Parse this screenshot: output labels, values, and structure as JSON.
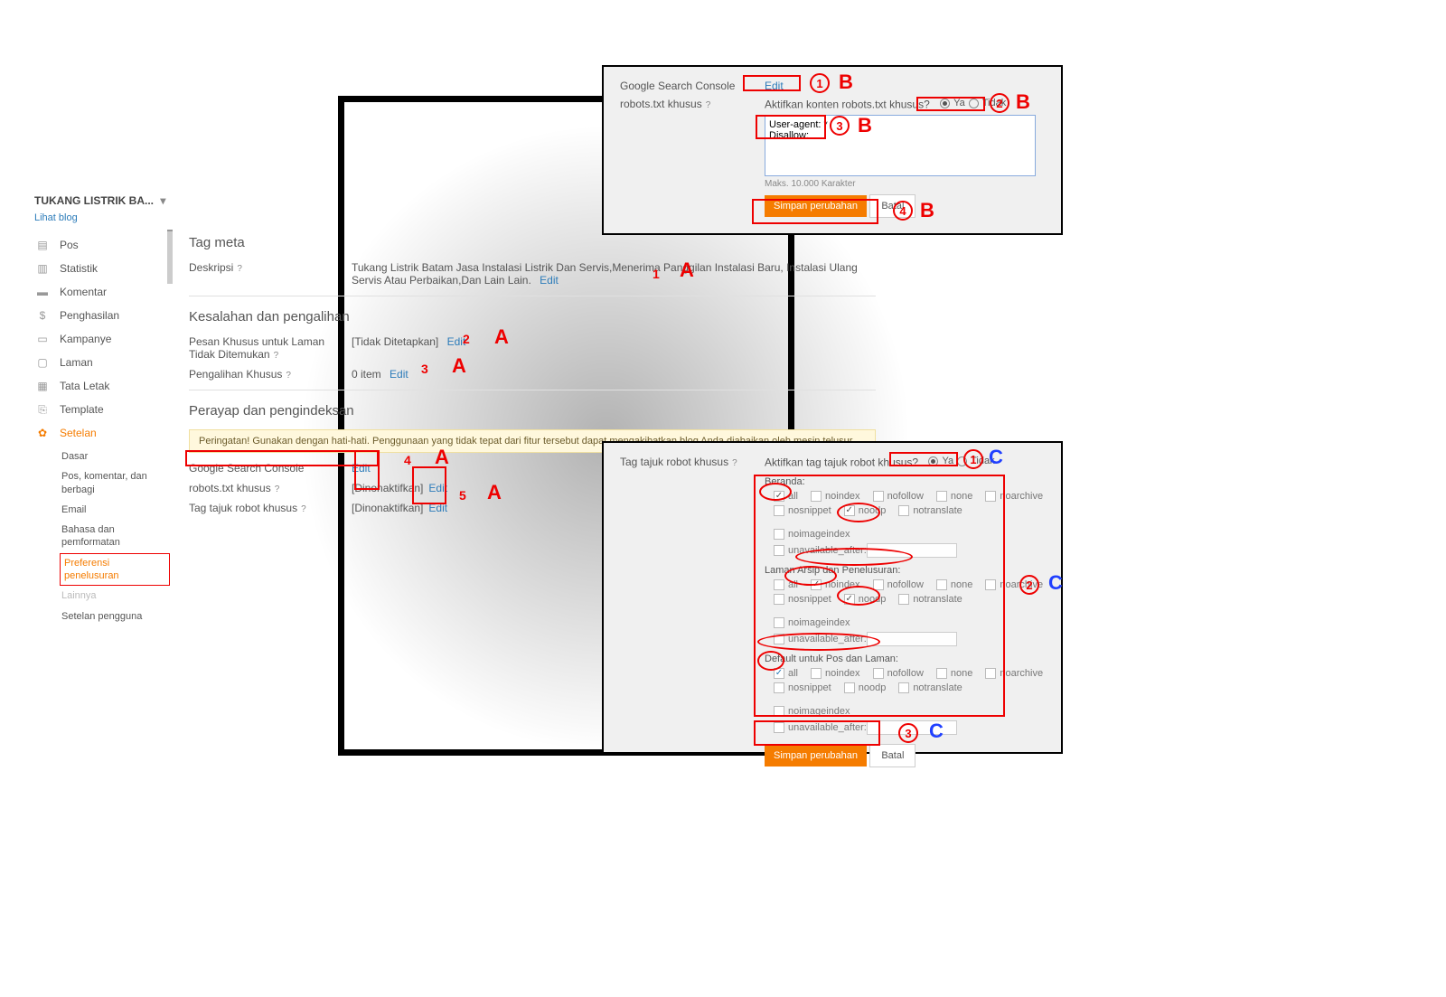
{
  "blog": {
    "title": "TUKANG LISTRIK BA...",
    "view_label": "Lihat blog"
  },
  "nav": [
    {
      "label": "Pos"
    },
    {
      "label": "Statistik"
    },
    {
      "label": "Komentar"
    },
    {
      "label": "Penghasilan"
    },
    {
      "label": "Kampanye"
    },
    {
      "label": "Laman"
    },
    {
      "label": "Tata Letak"
    },
    {
      "label": "Template"
    },
    {
      "label": "Setelan"
    }
  ],
  "subnav": [
    {
      "label": "Dasar"
    },
    {
      "label": "Pos, komentar, dan berbagi"
    },
    {
      "label": "Email"
    },
    {
      "label": "Bahasa dan pemformatan"
    },
    {
      "label": "Preferensi penelusuran"
    },
    {
      "label": "Lainnya"
    },
    {
      "label": "Setelan pengguna"
    }
  ],
  "sections": {
    "meta_title": "Tag meta",
    "errors_title": "Kesalahan dan pengalihan",
    "crawlers_title": "Perayap dan pengindeksan"
  },
  "meta": {
    "deskripsi_label": "Deskripsi",
    "deskripsi_value": "Tukang Listrik Batam Jasa Instalasi Listrik Dan Servis,Menerima Panggilan Instalasi Baru, Instalasi Ulang Servis Atau Perbaikan,Dan Lain Lain.",
    "edit": "Edit"
  },
  "errors": {
    "notfound_label": "Pesan Khusus untuk Laman Tidak Ditemukan",
    "notfound_value": "[Tidak Ditetapkan]",
    "redirect_label": "Pengalihan Khusus",
    "redirect_value": "0 item",
    "edit": "Edit"
  },
  "crawlers": {
    "warning": "Peringatan! Gunakan dengan hati-hati. Penggunaan yang tidak tepat dari fitur tersebut dapat mengakibatkan blog Anda diabaikan oleh mesin telusur.",
    "gsc_label": "Google Search Console",
    "robots_label": "robots.txt khusus",
    "header_label": "Tag tajuk robot khusus",
    "edit": "Edit",
    "disabled": "[Dinonaktifkan]"
  },
  "panelB": {
    "gsc_label": "Google Search Console",
    "edit": "Edit",
    "robots_label": "robots.txt khusus",
    "activate_label": "Aktifkan konten robots.txt khusus?",
    "yes": "Ya",
    "no": "Tidak",
    "textarea_value": "User-agent: *\nDisallow:",
    "maxnote": "Maks. 10.000 Karakter",
    "save": "Simpan perubahan",
    "cancel": "Batal"
  },
  "panelC": {
    "header_label": "Tag tajuk robot khusus",
    "activate_label": "Aktifkan tag tajuk robot khusus?",
    "yes": "Ya",
    "no": "Tidak",
    "group1": "Beranda:",
    "group2": "Laman Arsip dan Penelusuran:",
    "group3": "Default untuk Pos dan Laman:",
    "opts": {
      "all": "all",
      "noindex": "noindex",
      "nofollow": "nofollow",
      "none": "none",
      "noarchive": "noarchive",
      "nosnippet": "nosnippet",
      "noodp": "noodp",
      "notranslate": "notranslate",
      "noimageindex": "noimageindex",
      "unavailable_after": "unavailable_after:"
    },
    "save": "Simpan perubahan",
    "cancel": "Batal"
  }
}
